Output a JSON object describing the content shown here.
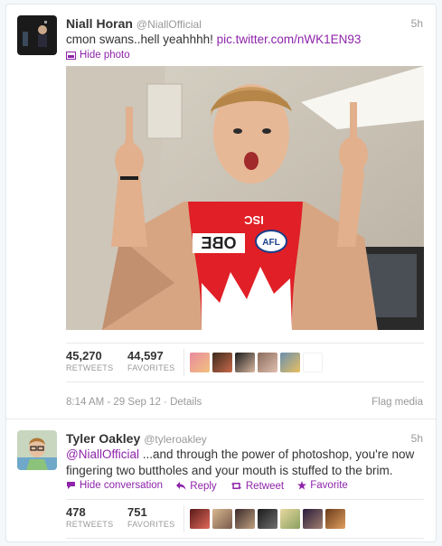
{
  "tweet1": {
    "name": "Niall Horan",
    "handle": "@NiallOfficial",
    "time": "5h",
    "text": "cmon swans..hell yeahhhh! ",
    "link": "pic.twitter.com/nWK1EN93",
    "hide_photo": "Hide photo",
    "retweets_count": "45,270",
    "retweets_label": "RETWEETS",
    "favorites_count": "44,597",
    "favorites_label": "FAVORITES",
    "timestamp": "8:14 AM - 29 Sep 12",
    "details": "Details",
    "flag_media": "Flag media",
    "jersey_text": "OBE",
    "jersey_logo": "AFL",
    "jersey_isc": "ISC"
  },
  "tweet2": {
    "name": "Tyler Oakley",
    "handle": "@tyleroakley",
    "time": "5h",
    "mention": "@NiallOfficial",
    "text": " ...and through the power of photoshop, you're now fingering two buttholes and your mouth is stuffed to the brim.",
    "hide_conversation": "Hide conversation",
    "reply": "Reply",
    "retweet": "Retweet",
    "favorite": "Favorite",
    "retweets_count": "478",
    "retweets_label": "RETWEETS",
    "favorites_count": "751",
    "favorites_label": "FAVORITES"
  },
  "colors": {
    "link": "#8e24aa",
    "muted": "#999999",
    "text": "#333333"
  },
  "icons": [
    "photo-icon",
    "conversation-icon",
    "reply-icon",
    "retweet-icon",
    "favorite-star-icon"
  ]
}
